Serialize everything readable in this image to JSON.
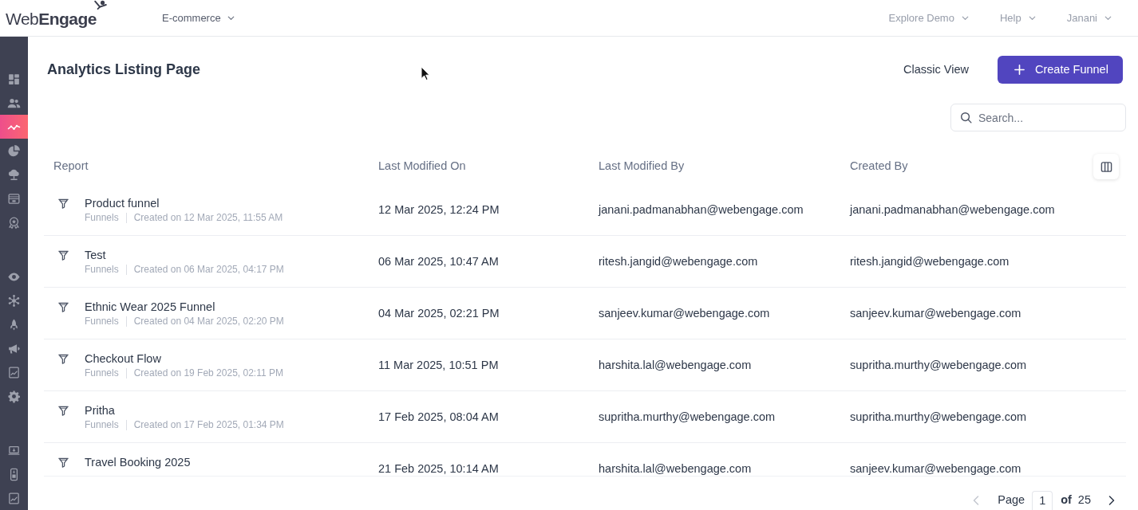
{
  "top_bar": {
    "logo": "Web**Engage**",
    "workspace": "E-commerce",
    "menus": [
      "Explore Demo",
      "Help",
      "Janani"
    ]
  },
  "sidebar": {
    "groups": [
      {
        "items": [
          {
            "selected": false
          },
          {
            "selected": false
          },
          {
            "selected": true
          },
          {
            "selected": false
          },
          {
            "selected": false
          },
          {
            "selected": false
          },
          {
            "selected": false
          }
        ]
      },
      {
        "items": [
          {
            "selected": false
          },
          {
            "selected": false
          },
          {
            "selected": false
          },
          {
            "selected": false
          },
          {
            "selected": false
          },
          {
            "selected": false
          }
        ]
      },
      {
        "items": [
          {
            "selected": false
          },
          {
            "selected": false
          },
          {
            "selected": false
          }
        ]
      }
    ]
  },
  "page": {
    "title": "Analytics Listing Page",
    "classic_view": "Classic View",
    "create_button": "Create Funnel",
    "search": {
      "placeholder": "Search..."
    }
  },
  "table": {
    "columns": [
      "Report",
      "Last Modified On",
      "Last Modified By",
      "Created By"
    ],
    "rows": [
      {
        "name": "Product funnel",
        "type": "Funnels",
        "created_on": "Created on 12 Mar 2025, 11:55 AM",
        "modified_on": "12 Mar 2025, 12:24 PM",
        "modified_by": "janani.padmanabhan@webengage.com",
        "created_by": "janani.padmanabhan@webengage.com"
      },
      {
        "name": "Test",
        "type": "Funnels",
        "created_on": "Created on 06 Mar 2025, 04:17 PM",
        "modified_on": "06 Mar 2025, 10:47 AM",
        "modified_by": "ritesh.jangid@webengage.com",
        "created_by": "ritesh.jangid@webengage.com"
      },
      {
        "name": "Ethnic Wear 2025 Funnel",
        "type": "Funnels",
        "created_on": "Created on 04 Mar 2025, 02:20 PM",
        "modified_on": "04 Mar 2025, 02:21 PM",
        "modified_by": "sanjeev.kumar@webengage.com",
        "created_by": "sanjeev.kumar@webengage.com"
      },
      {
        "name": "Checkout Flow",
        "type": "Funnels",
        "created_on": "Created on 19 Feb 2025, 02:11 PM",
        "modified_on": "11 Mar 2025, 10:51 PM",
        "modified_by": "harshita.lal@webengage.com",
        "created_by": "supritha.murthy@webengage.com"
      },
      {
        "name": "Pritha",
        "type": "Funnels",
        "created_on": "Created on 17 Feb 2025, 01:34 PM",
        "modified_on": "17 Feb 2025, 08:04 AM",
        "modified_by": "supritha.murthy@webengage.com",
        "created_by": "supritha.murthy@webengage.com"
      },
      {
        "name": "Travel Booking 2025",
        "modified_on": "21 Feb 2025, 10:14 AM",
        "modified_by": "harshita.lal@webengage.com",
        "created_by": "sanjeev.kumar@webengage.com"
      }
    ]
  },
  "pagination": {
    "prev_disabled": true,
    "label": "Page",
    "page": "1",
    "of": "of",
    "total": "25",
    "next_disabled": false
  }
}
